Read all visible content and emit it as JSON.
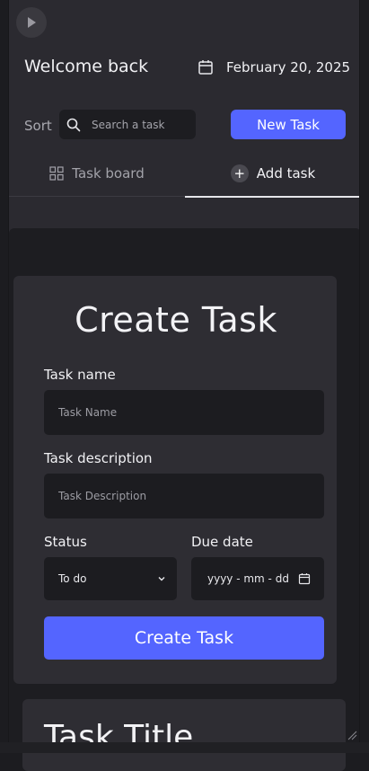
{
  "header": {
    "welcome": "Welcome back",
    "date": "February 20, 2025"
  },
  "toolbar": {
    "sort_label": "Sort",
    "search_placeholder": "Search a task",
    "new_task_label": "New Task"
  },
  "tabs": [
    {
      "label": "Task board",
      "icon": "board-icon",
      "active": false
    },
    {
      "label": "Add task",
      "icon": "plus-circle-icon",
      "active": true
    }
  ],
  "form": {
    "title": "Create Task",
    "name_label": "Task name",
    "name_placeholder": "Task Name",
    "description_label": "Task description",
    "description_placeholder": "Task Description",
    "status_label": "Status",
    "status_value": "To do",
    "due_label": "Due date",
    "due_placeholder": "yyyy - mm - dd",
    "submit_label": "Create Task"
  },
  "preview_card": {
    "title": "Task Title"
  },
  "colors": {
    "accent": "#5465ff",
    "background": "#2b2a30",
    "panel": "#1d1d21",
    "card": "#2e2d33"
  }
}
